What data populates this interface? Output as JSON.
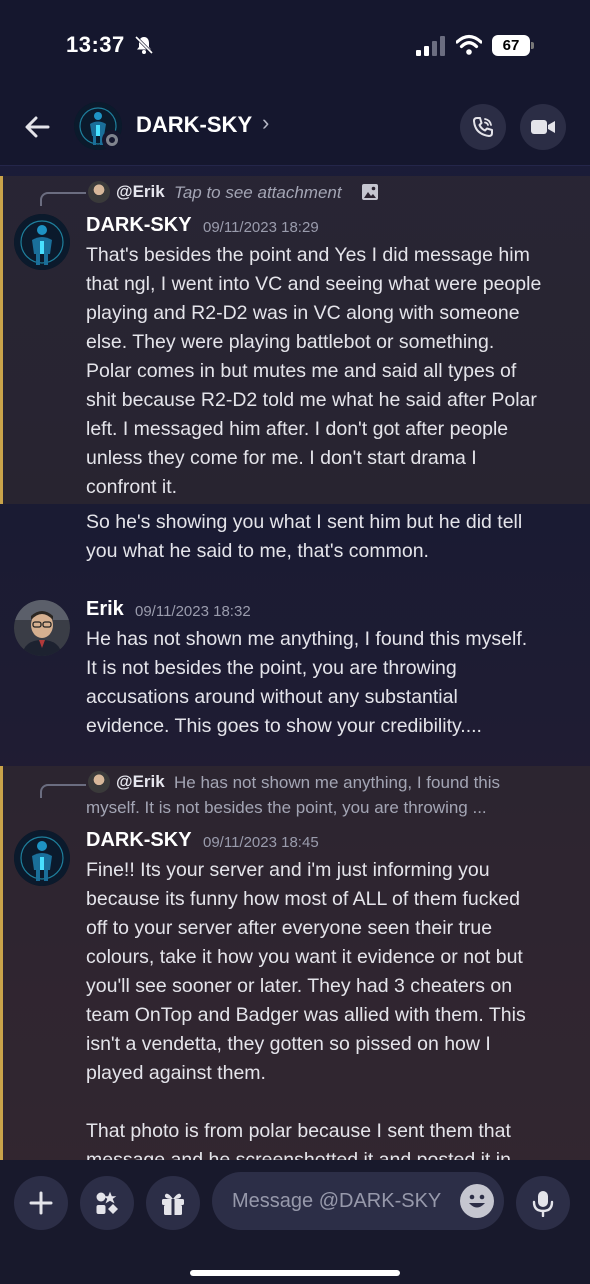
{
  "status_bar": {
    "time": "13:37",
    "battery": "67"
  },
  "header": {
    "title": "DARK-SKY",
    "chevron": "›"
  },
  "messages": [
    {
      "reply": {
        "name": "@Erik",
        "text": "Tap to see attachment"
      },
      "author": "DARK-SKY",
      "timestamp": "09/11/2023 18:29",
      "lines": [
        "That's besides the point and Yes I did message him",
        "that ngl, I went into VC and seeing what were people",
        "playing and R2-D2 was in VC along with someone",
        "else. They were playing battlebot or something.",
        "Polar comes in but mutes me and said all types of",
        "shit because R2-D2 told me what he said after Polar",
        "left. I messaged him after. I don't got after people",
        "unless they come for me. I don't start drama I",
        "confront it."
      ],
      "continuation": [
        "So he's showing you what I sent him but he did tell",
        "you what he said to me, that's common."
      ]
    },
    {
      "author": "Erik",
      "timestamp": "09/11/2023 18:32",
      "lines": [
        "He has not shown me anything, I found this myself.",
        "It is not besides the point, you are throwing",
        "accusations around without any substantial",
        "evidence. This goes to show your credibility...."
      ]
    },
    {
      "reply": {
        "name": "@Erik",
        "text_line1": "He has not shown me anything, I found this",
        "text_line2": "myself.  It is not besides the point, you are throwing ..."
      },
      "author": "DARK-SKY",
      "timestamp": "09/11/2023 18:45",
      "lines": [
        "Fine!! Its your server and i'm just informing you",
        "because its funny how most of ALL of them fucked",
        "off to your server after everyone seen their true",
        "colours, take it how you want it evidence or not but",
        "you'll see sooner or later. They had 3 cheaters on",
        "team OnTop and Badger was allied with them. This",
        "isn't a vendetta, they gotten so pissed on how I",
        "played against them.",
        "",
        "That photo is from polar because I sent them that",
        "message and he screenshotted it and posted it in"
      ]
    }
  ],
  "composer": {
    "placeholder": "Message @DARK-SKY"
  },
  "icons": {
    "back": "back-arrow-icon",
    "call": "phone-icon",
    "video": "video-camera-icon",
    "plus": "plus-icon",
    "apps": "apps-icon",
    "gift": "gift-icon",
    "emoji": "emoji-icon",
    "mic": "microphone-icon"
  },
  "colors": {
    "highlight_bar": "#c9a34a",
    "header_bg": "#15172e",
    "accent_text": "#ffffff"
  }
}
